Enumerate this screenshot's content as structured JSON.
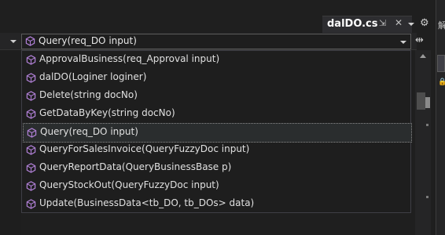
{
  "tab": {
    "title": "dalDO.cs",
    "pin_glyph": "⇲",
    "close_glyph": "✕",
    "settings_glyph": "⚙"
  },
  "navbar": {
    "member_value": "Query(req_DO input)",
    "split_glyph": "⇹"
  },
  "side_panel": {
    "glyph": "解",
    "lock_glyph": "🔒"
  },
  "dropdown": {
    "items": [
      {
        "label": "ApprovalBusiness(req_Approval input)",
        "icon": "method-cube-icon"
      },
      {
        "label": "dalDO(Loginer loginer)",
        "icon": "method-cube-icon"
      },
      {
        "label": "Delete(string docNo)",
        "icon": "method-cube-icon"
      },
      {
        "label": "GetDataByKey(string docNo)",
        "icon": "method-cube-icon"
      },
      {
        "label": "Query(req_DO input)",
        "icon": "method-cube-icon",
        "selected": true
      },
      {
        "label": "QueryForSalesInvoice(QueryFuzzyDoc input)",
        "icon": "method-cube-icon"
      },
      {
        "label": "QueryReportData(QueryBusinessBase p)",
        "icon": "method-cube-icon"
      },
      {
        "label": "QueryStockOut(QueryFuzzyDoc input)",
        "icon": "method-cube-icon"
      },
      {
        "label": "Update(BusinessData<tb_DO, tb_DOs> data)",
        "icon": "method-cube-icon"
      }
    ]
  },
  "colors": {
    "method_icon": "#b180d7",
    "background": "#1e1e1e",
    "selection_border": "#8a8a8a"
  }
}
